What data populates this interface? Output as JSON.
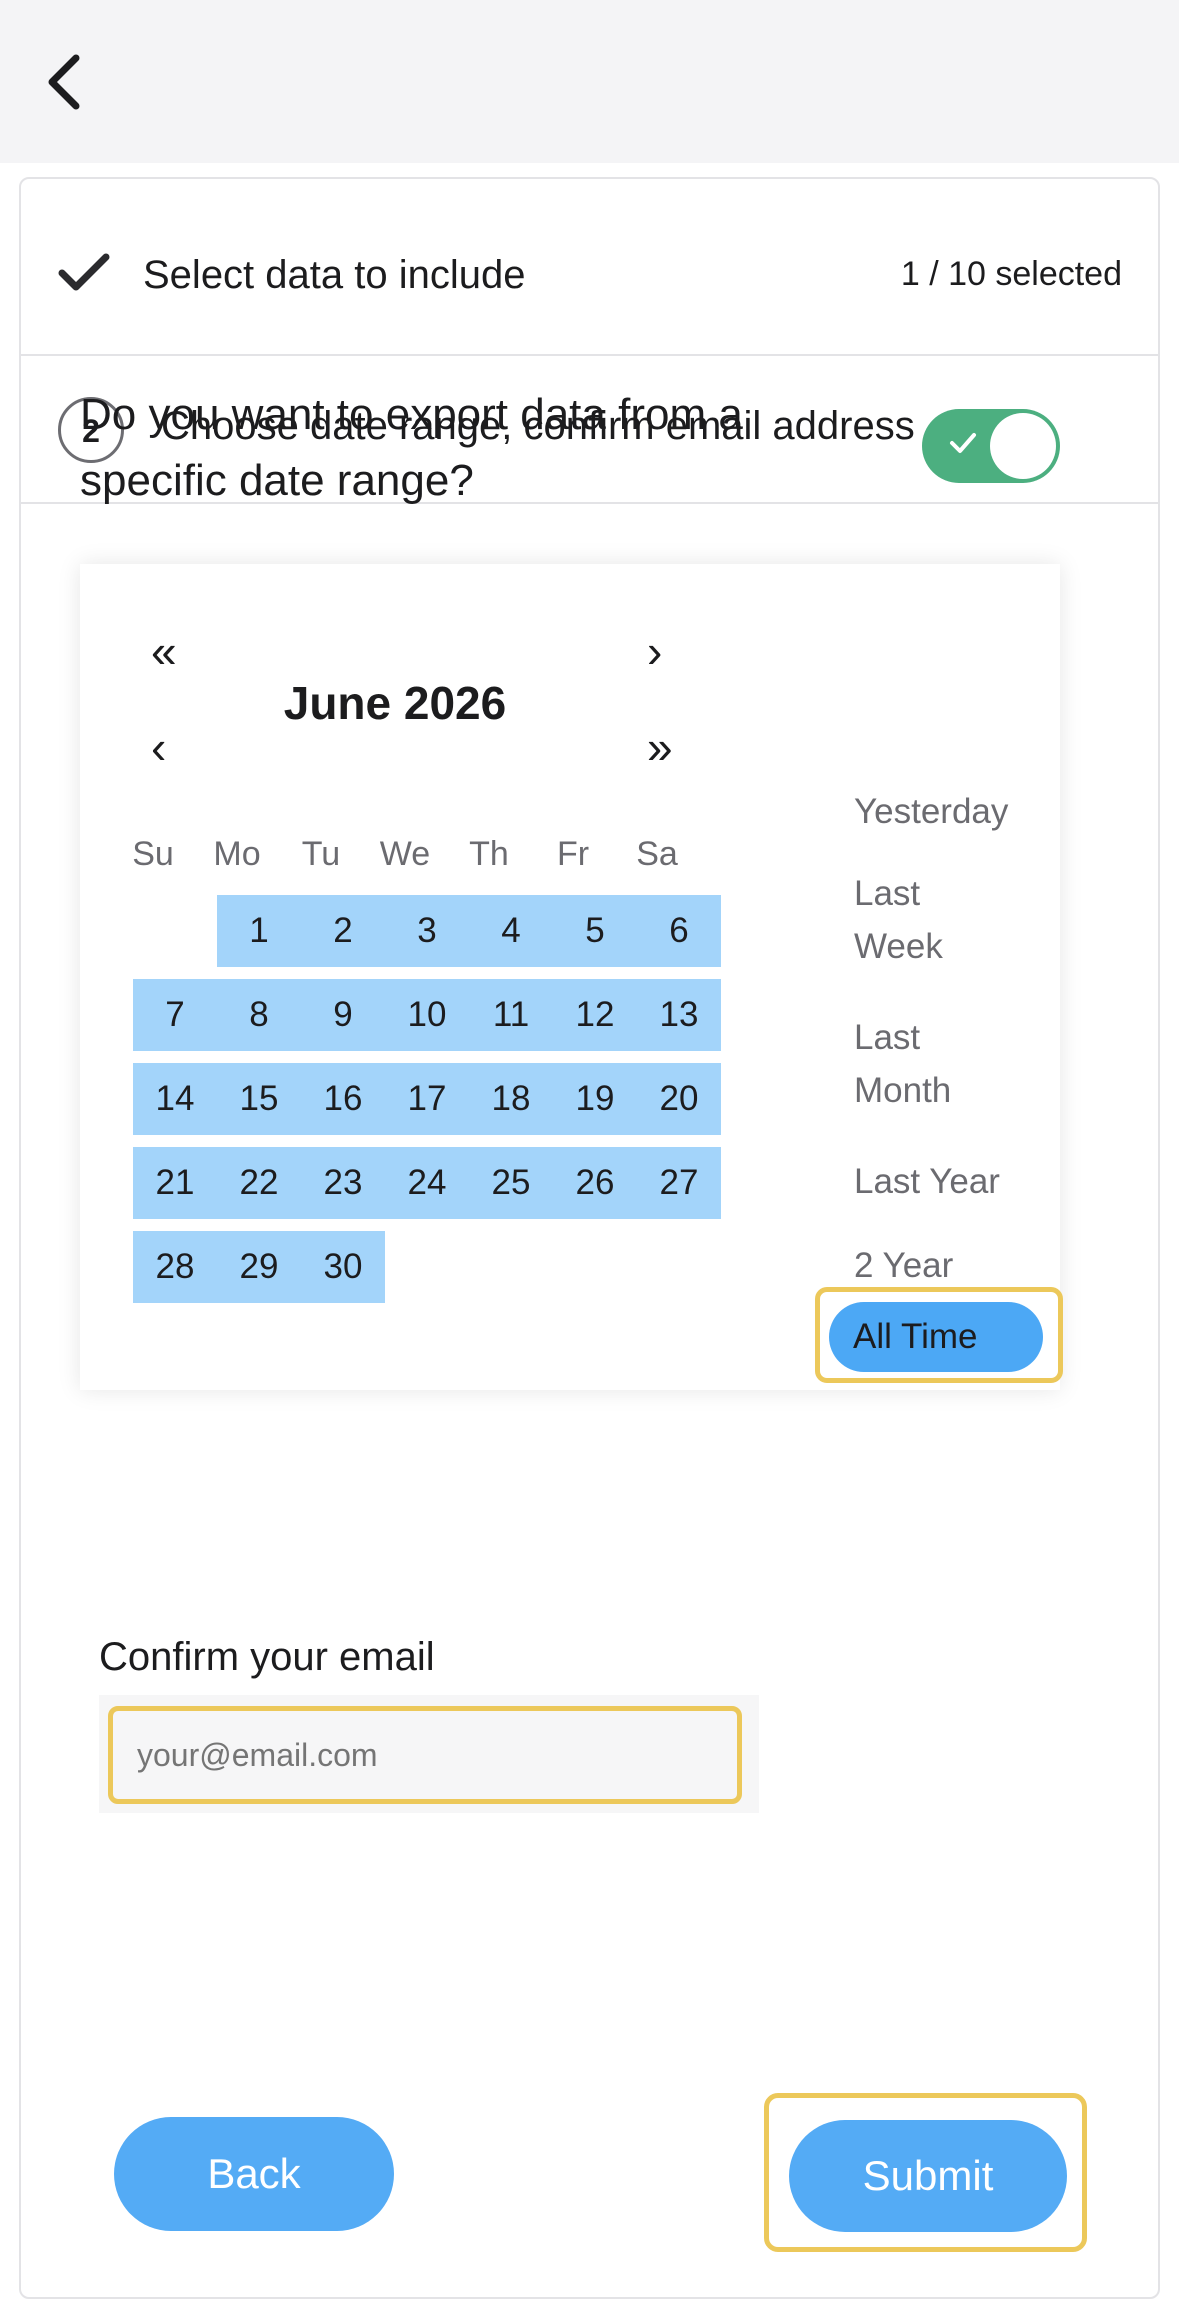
{
  "header": {
    "back_icon": "chevron-left-icon"
  },
  "steps": [
    {
      "icon": "checkmark-icon",
      "title": "Select data to include",
      "count": "1 / 10 selected"
    },
    {
      "number": "2",
      "title": "Choose date range, confirm email address"
    }
  ],
  "date_range": {
    "question": "Do you want to export data from a specific date range?",
    "toggle_on": true,
    "toggle_color": "#4caf80"
  },
  "calendar": {
    "month_title": "June 2026",
    "nav": {
      "prev_year": "«",
      "next_month": "›",
      "prev_month": "‹",
      "next_year": "»"
    },
    "weekdays": [
      "Su",
      "Mo",
      "Tu",
      "We",
      "Th",
      "Fr",
      "Sa"
    ],
    "first_weekday_index": 1,
    "days": [
      "1",
      "2",
      "3",
      "4",
      "5",
      "6",
      "7",
      "8",
      "9",
      "10",
      "11",
      "12",
      "13",
      "14",
      "15",
      "16",
      "17",
      "18",
      "19",
      "20",
      "21",
      "22",
      "23",
      "24",
      "25",
      "26",
      "27",
      "28",
      "29",
      "30"
    ],
    "highlight_color": "#a3d4fa"
  },
  "presets": {
    "yesterday": "Yesterday",
    "last_week": [
      "Last",
      "Week"
    ],
    "last_month": [
      "Last",
      "Month"
    ],
    "last_year": "Last Year",
    "two_year": "2 Year",
    "all_time": "All Time",
    "selected": "All Time"
  },
  "email": {
    "label": "Confirm your email",
    "placeholder": "your@email.com",
    "value": ""
  },
  "actions": {
    "back": "Back",
    "submit": "Submit"
  },
  "colors": {
    "accent": "#54abf5",
    "highlight_outline": "#ecc85a"
  }
}
